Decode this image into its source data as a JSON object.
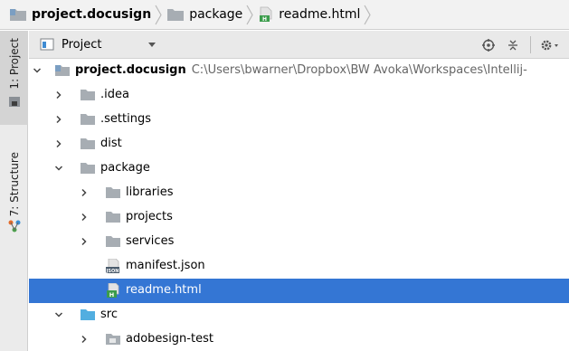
{
  "breadcrumb": [
    {
      "label": "project.docusign",
      "icon": "project-folder-icon",
      "bold": true
    },
    {
      "label": "package",
      "icon": "folder-icon",
      "bold": false
    },
    {
      "label": "readme.html",
      "icon": "html-file-icon",
      "bold": false
    }
  ],
  "tool_strip": {
    "project_tab": "1: Project",
    "structure_tab": "7: Structure"
  },
  "project_panel": {
    "title": "Project",
    "view_dropdown_icon": "chevron-down-icon",
    "tools": [
      "locate-target-icon",
      "collapse-all-icon",
      "gear-icon"
    ]
  },
  "tree": [
    {
      "label": "project.docusign",
      "path": "C:\\Users\\bwarner\\Dropbox\\BW Avoka\\Workspaces\\Intellij-",
      "level": 0,
      "arrow": "down",
      "icon": "project-folder",
      "bold": true,
      "selected": false
    },
    {
      "label": ".idea",
      "level": 1,
      "arrow": "right",
      "icon": "folder",
      "selected": false
    },
    {
      "label": ".settings",
      "level": 1,
      "arrow": "right",
      "icon": "folder",
      "selected": false
    },
    {
      "label": "dist",
      "level": 1,
      "arrow": "right",
      "icon": "folder",
      "selected": false
    },
    {
      "label": "package",
      "level": 1,
      "arrow": "down",
      "icon": "folder",
      "selected": false
    },
    {
      "label": "libraries",
      "level": 2,
      "arrow": "right",
      "icon": "folder",
      "selected": false
    },
    {
      "label": "projects",
      "level": 2,
      "arrow": "right",
      "icon": "folder",
      "selected": false
    },
    {
      "label": "services",
      "level": 2,
      "arrow": "right",
      "icon": "folder",
      "selected": false
    },
    {
      "label": "manifest.json",
      "level": 2,
      "arrow": "none",
      "icon": "json-file",
      "selected": false
    },
    {
      "label": "readme.html",
      "level": 2,
      "arrow": "none",
      "icon": "html-file",
      "selected": true
    },
    {
      "label": "src",
      "level": 1,
      "arrow": "down",
      "icon": "source-folder",
      "selected": false
    },
    {
      "label": "adobesign-test",
      "level": 2,
      "arrow": "right",
      "icon": "module-folder",
      "selected": false
    }
  ],
  "icon_text": {
    "json": "JSON",
    "html": "H"
  },
  "colors": {
    "selection": "#3476d4",
    "folder": "#a7adb3",
    "project_folder": "#7b9ec2",
    "source_folder": "#52aee0",
    "html_green": "#3b9c4b"
  }
}
